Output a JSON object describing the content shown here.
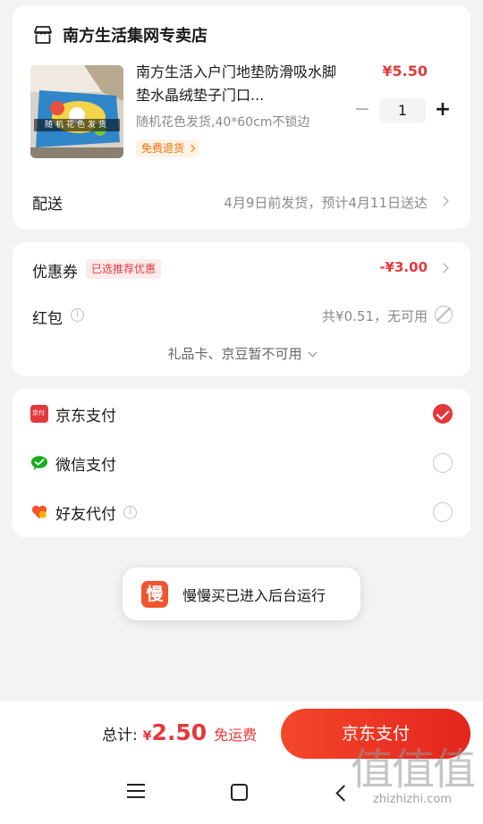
{
  "shop": {
    "name": "南方生活集网专卖店",
    "item": {
      "title": "南方生活入户门地垫防滑吸水脚垫水晶绒垫子门口...",
      "thumb_caption": "随机花色发货",
      "spec": "随机花色发货,40*60cm不锁边",
      "return_tag": "免费退货",
      "price": "¥5.50",
      "quantity": "1"
    },
    "delivery": {
      "label": "配送",
      "value": "4月9日前发货，预计4月11日送达"
    }
  },
  "promo": {
    "coupon_label": "优惠券",
    "coupon_badge": "已选推荐优惠",
    "coupon_value": "-¥3.00",
    "redpacket_label": "红包",
    "redpacket_value": "共¥0.51，无可用",
    "gift_text": "礼品卡、京豆暂不可用"
  },
  "payment": {
    "options": [
      {
        "label": "京东支付",
        "icon": "jd-pay-icon",
        "checked": true
      },
      {
        "label": "微信支付",
        "icon": "wechat-pay-icon",
        "checked": false
      },
      {
        "label": "好友代付",
        "icon": "friend-pay-icon",
        "checked": false
      }
    ],
    "jd_icon_text": "京付"
  },
  "toast": {
    "logo": "慢",
    "text": "慢慢买已进入后台运行"
  },
  "footer": {
    "total_label": "总计:",
    "currency": "¥",
    "total_amount": "2.50",
    "shipping": "免运费",
    "pay_button": "京东支付"
  },
  "watermark": {
    "big": "值值值",
    "small": "zhizhizhi.com"
  },
  "colors": {
    "accent": "#e4393c",
    "orange": "#ff6a00",
    "wechat": "#1aad19"
  }
}
